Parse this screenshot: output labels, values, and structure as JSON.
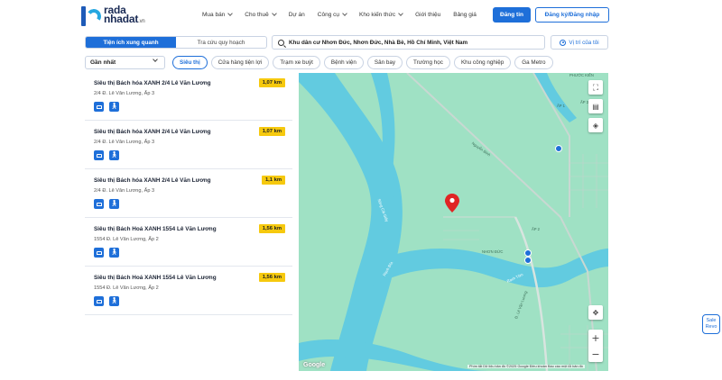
{
  "header": {
    "logo_line1": "rada",
    "logo_line2": "nhadat",
    "logo_suffix": ".vn",
    "nav": [
      {
        "label": "Mua bán",
        "has_dropdown": true
      },
      {
        "label": "Cho thuê",
        "has_dropdown": true
      },
      {
        "label": "Dự án",
        "has_dropdown": false
      },
      {
        "label": "Công cụ",
        "has_dropdown": true
      },
      {
        "label": "Kho kiến thức",
        "has_dropdown": true
      },
      {
        "label": "Giới thiệu",
        "has_dropdown": false
      },
      {
        "label": "Bảng giá",
        "has_dropdown": false
      }
    ],
    "post_button": "Đăng tin",
    "login_button": "Đăng ký/Đăng nhập"
  },
  "toolbar": {
    "tabs": [
      {
        "label": "Tiện ích xung quanh",
        "active": true
      },
      {
        "label": "Tra cứu quy hoạch",
        "active": false
      }
    ],
    "search_value": "Khu dân cư Nhơn Đức, Nhơn Đức, Nhà Bè, Hồ Chí Minh, Việt Nam",
    "my_location": "Vị trí của tôi"
  },
  "filters": {
    "sort_value": "Gần nhất",
    "chips": [
      {
        "label": "Siêu thị",
        "active": true
      },
      {
        "label": "Cửa hàng tiện lợi",
        "active": false
      },
      {
        "label": "Trạm xe buýt",
        "active": false
      },
      {
        "label": "Bệnh viện",
        "active": false
      },
      {
        "label": "Sân bay",
        "active": false
      },
      {
        "label": "Trường học",
        "active": false
      },
      {
        "label": "Khu công nghiệp",
        "active": false
      },
      {
        "label": "Ga Metro",
        "active": false
      }
    ]
  },
  "results": [
    {
      "title": "Siêu thị Bách hóa XANH 2/4 Lê Văn Lương",
      "address": "2/4 Đ. Lê Văn Lương, Ấp 3",
      "distance": "1,07 km"
    },
    {
      "title": "Siêu thị Bách hóa XANH 2/4 Lê Văn Lương",
      "address": "2/4 Đ. Lê Văn Lương, Ấp 3",
      "distance": "1,07 km"
    },
    {
      "title": "Siêu thị Bách hóa XANH 2/4 Lê Văn Lương",
      "address": "2/4 Đ. Lê Văn Lương, Ấp 3",
      "distance": "1,1 km"
    },
    {
      "title": "Siêu thị Bách Hoá XANH 1554 Lê Văn Lương",
      "address": "1554 Đ. Lê Văn Lương, Ấp 2",
      "distance": "1,56 km"
    },
    {
      "title": "Siêu thị Bách Hoá XANH 1554 Lê Văn Lương",
      "address": "1554 Đ. Lê Văn Lương, Ấp 2",
      "distance": "1,56 km"
    }
  ],
  "map": {
    "labels": {
      "song_cai_gia": "Sông Cái Giây",
      "rach_tom": "Rạch Tôm",
      "nhon_duc": "NHƠN ĐỨC",
      "ap1": "ẤP 1",
      "ap2": "ẤP 2",
      "ap3": "ẤP 3",
      "le_van_luong": "Đ. Lê Văn Lương",
      "nguyen_binh": "Nguyễn Bình",
      "rach_dia": "Rạch Đĩa",
      "phuoc_kien": "PHƯỚC KIỂN"
    },
    "google": "Google",
    "attribution": "Phím tắt   Dữ liệu bản đồ ©2025 Google   Điều khoản   Báo cáo một lỗi bản đồ",
    "colors": {
      "land": "#9fe1c4",
      "water": "#62cbe0",
      "pin": "#e02424"
    }
  },
  "sale_widget": {
    "line1": "Sale",
    "line2": "Revo"
  }
}
